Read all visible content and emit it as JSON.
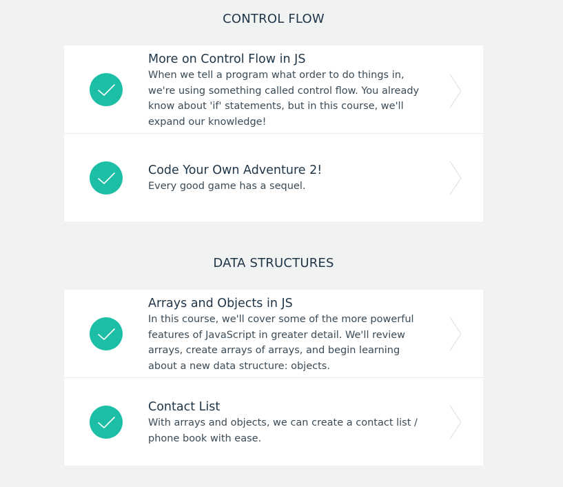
{
  "sections": [
    {
      "title": "CONTROL FLOW",
      "items": [
        {
          "title": "More on Control Flow in JS",
          "description": "When we tell a program what order to do things in, we're using something called control flow. You already know about 'if' statements, but in this course, we'll expand our knowledge!",
          "completed": true
        },
        {
          "title": "Code Your Own Adventure 2!",
          "description": "Every good game has a sequel.",
          "completed": true
        }
      ]
    },
    {
      "title": "DATA STRUCTURES",
      "items": [
        {
          "title": "Arrays and Objects in JS",
          "description": "In this course, we'll cover some of the more powerful features of JavaScript in greater detail. We'll review arrays, create arrays of arrays, and begin learning about a new data structure: objects.",
          "completed": true
        },
        {
          "title": "Contact List",
          "description": "With arrays and objects, we can create a contact list / phone book with ease.",
          "completed": true
        }
      ]
    }
  ],
  "icons": {
    "completed": "checkmark-icon",
    "open": "chevron-right-icon"
  },
  "colors": {
    "background": "#f1f2f2",
    "card": "#ffffff",
    "check_circle": "#1cbfa5",
    "heading": "#1f3547",
    "chevron": "#e2e5e5"
  }
}
